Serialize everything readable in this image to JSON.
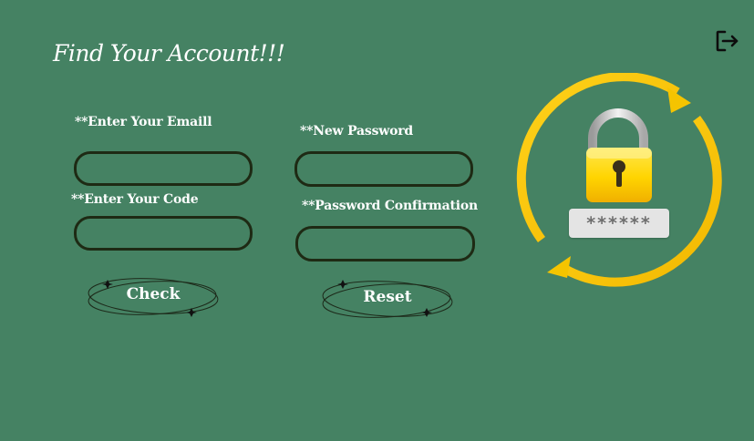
{
  "page": {
    "title": "Find Your Account!!!"
  },
  "email_form": {
    "email_label": "**Enter Your Emaill",
    "email_value": "",
    "code_label": "**Enter Your Code",
    "code_value": "",
    "check_button": "Check"
  },
  "reset_form": {
    "new_password_label": "**New Password",
    "new_password_value": "",
    "confirm_label": "**Password Confirmation",
    "confirm_value": "",
    "reset_button": "Reset"
  },
  "illustration": {
    "password_mask": "******",
    "icon": "padlock-refresh-icon"
  },
  "header": {
    "logout_icon": "logout-icon"
  },
  "colors": {
    "background": "#458263",
    "input_border": "#1e2a14",
    "text": "#ffffff",
    "accent_yellow": "#f5c400"
  }
}
